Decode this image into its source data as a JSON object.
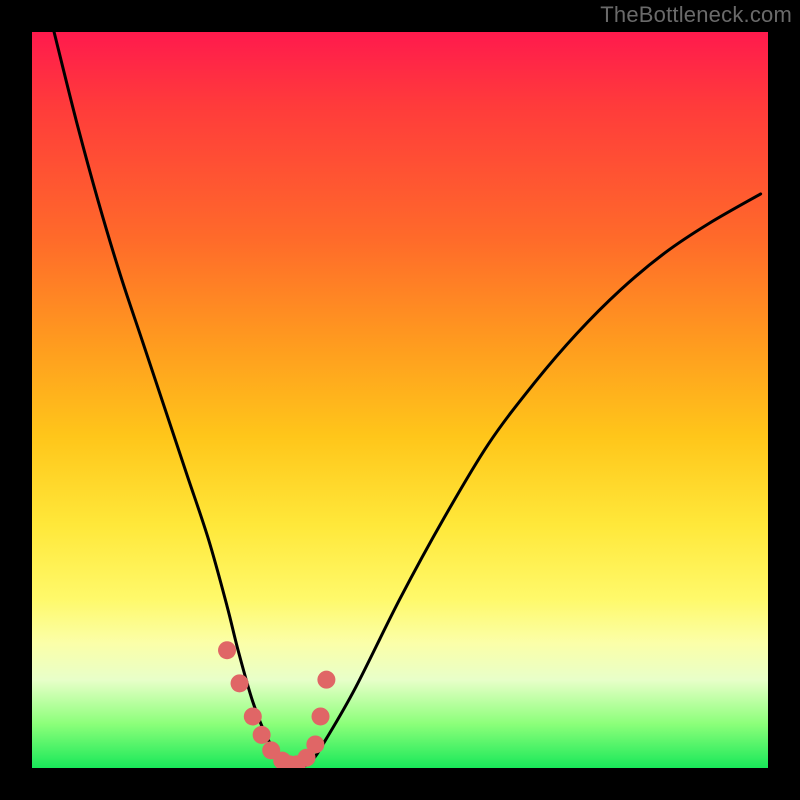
{
  "watermark": "TheBottleneck.com",
  "chart_data": {
    "type": "line",
    "title": "",
    "xlabel": "",
    "ylabel": "",
    "xlim": [
      0,
      100
    ],
    "ylim": [
      0,
      100
    ],
    "series": [
      {
        "name": "bottleneck-curve",
        "x": [
          3,
          6,
          9,
          12,
          15,
          18,
          21,
          24,
          26.5,
          28,
          30,
          32,
          34,
          36,
          38,
          40,
          44,
          50,
          56,
          62,
          68,
          74,
          80,
          86,
          92,
          99
        ],
        "y": [
          100,
          88,
          77,
          67,
          58,
          49,
          40,
          31,
          22,
          16,
          9,
          4,
          1,
          0,
          1,
          4,
          11,
          23,
          34,
          44,
          52,
          59,
          65,
          70,
          74,
          78
        ]
      }
    ],
    "markers": {
      "name": "highlight-dots",
      "color": "#e06666",
      "x": [
        26.5,
        28.2,
        30.0,
        31.2,
        32.5,
        34.0,
        35.0,
        36.0,
        37.3,
        38.5,
        39.2,
        40.0
      ],
      "y": [
        16.0,
        11.5,
        7.0,
        4.5,
        2.4,
        1.0,
        0.5,
        0.5,
        1.4,
        3.2,
        7.0,
        12.0
      ]
    }
  }
}
